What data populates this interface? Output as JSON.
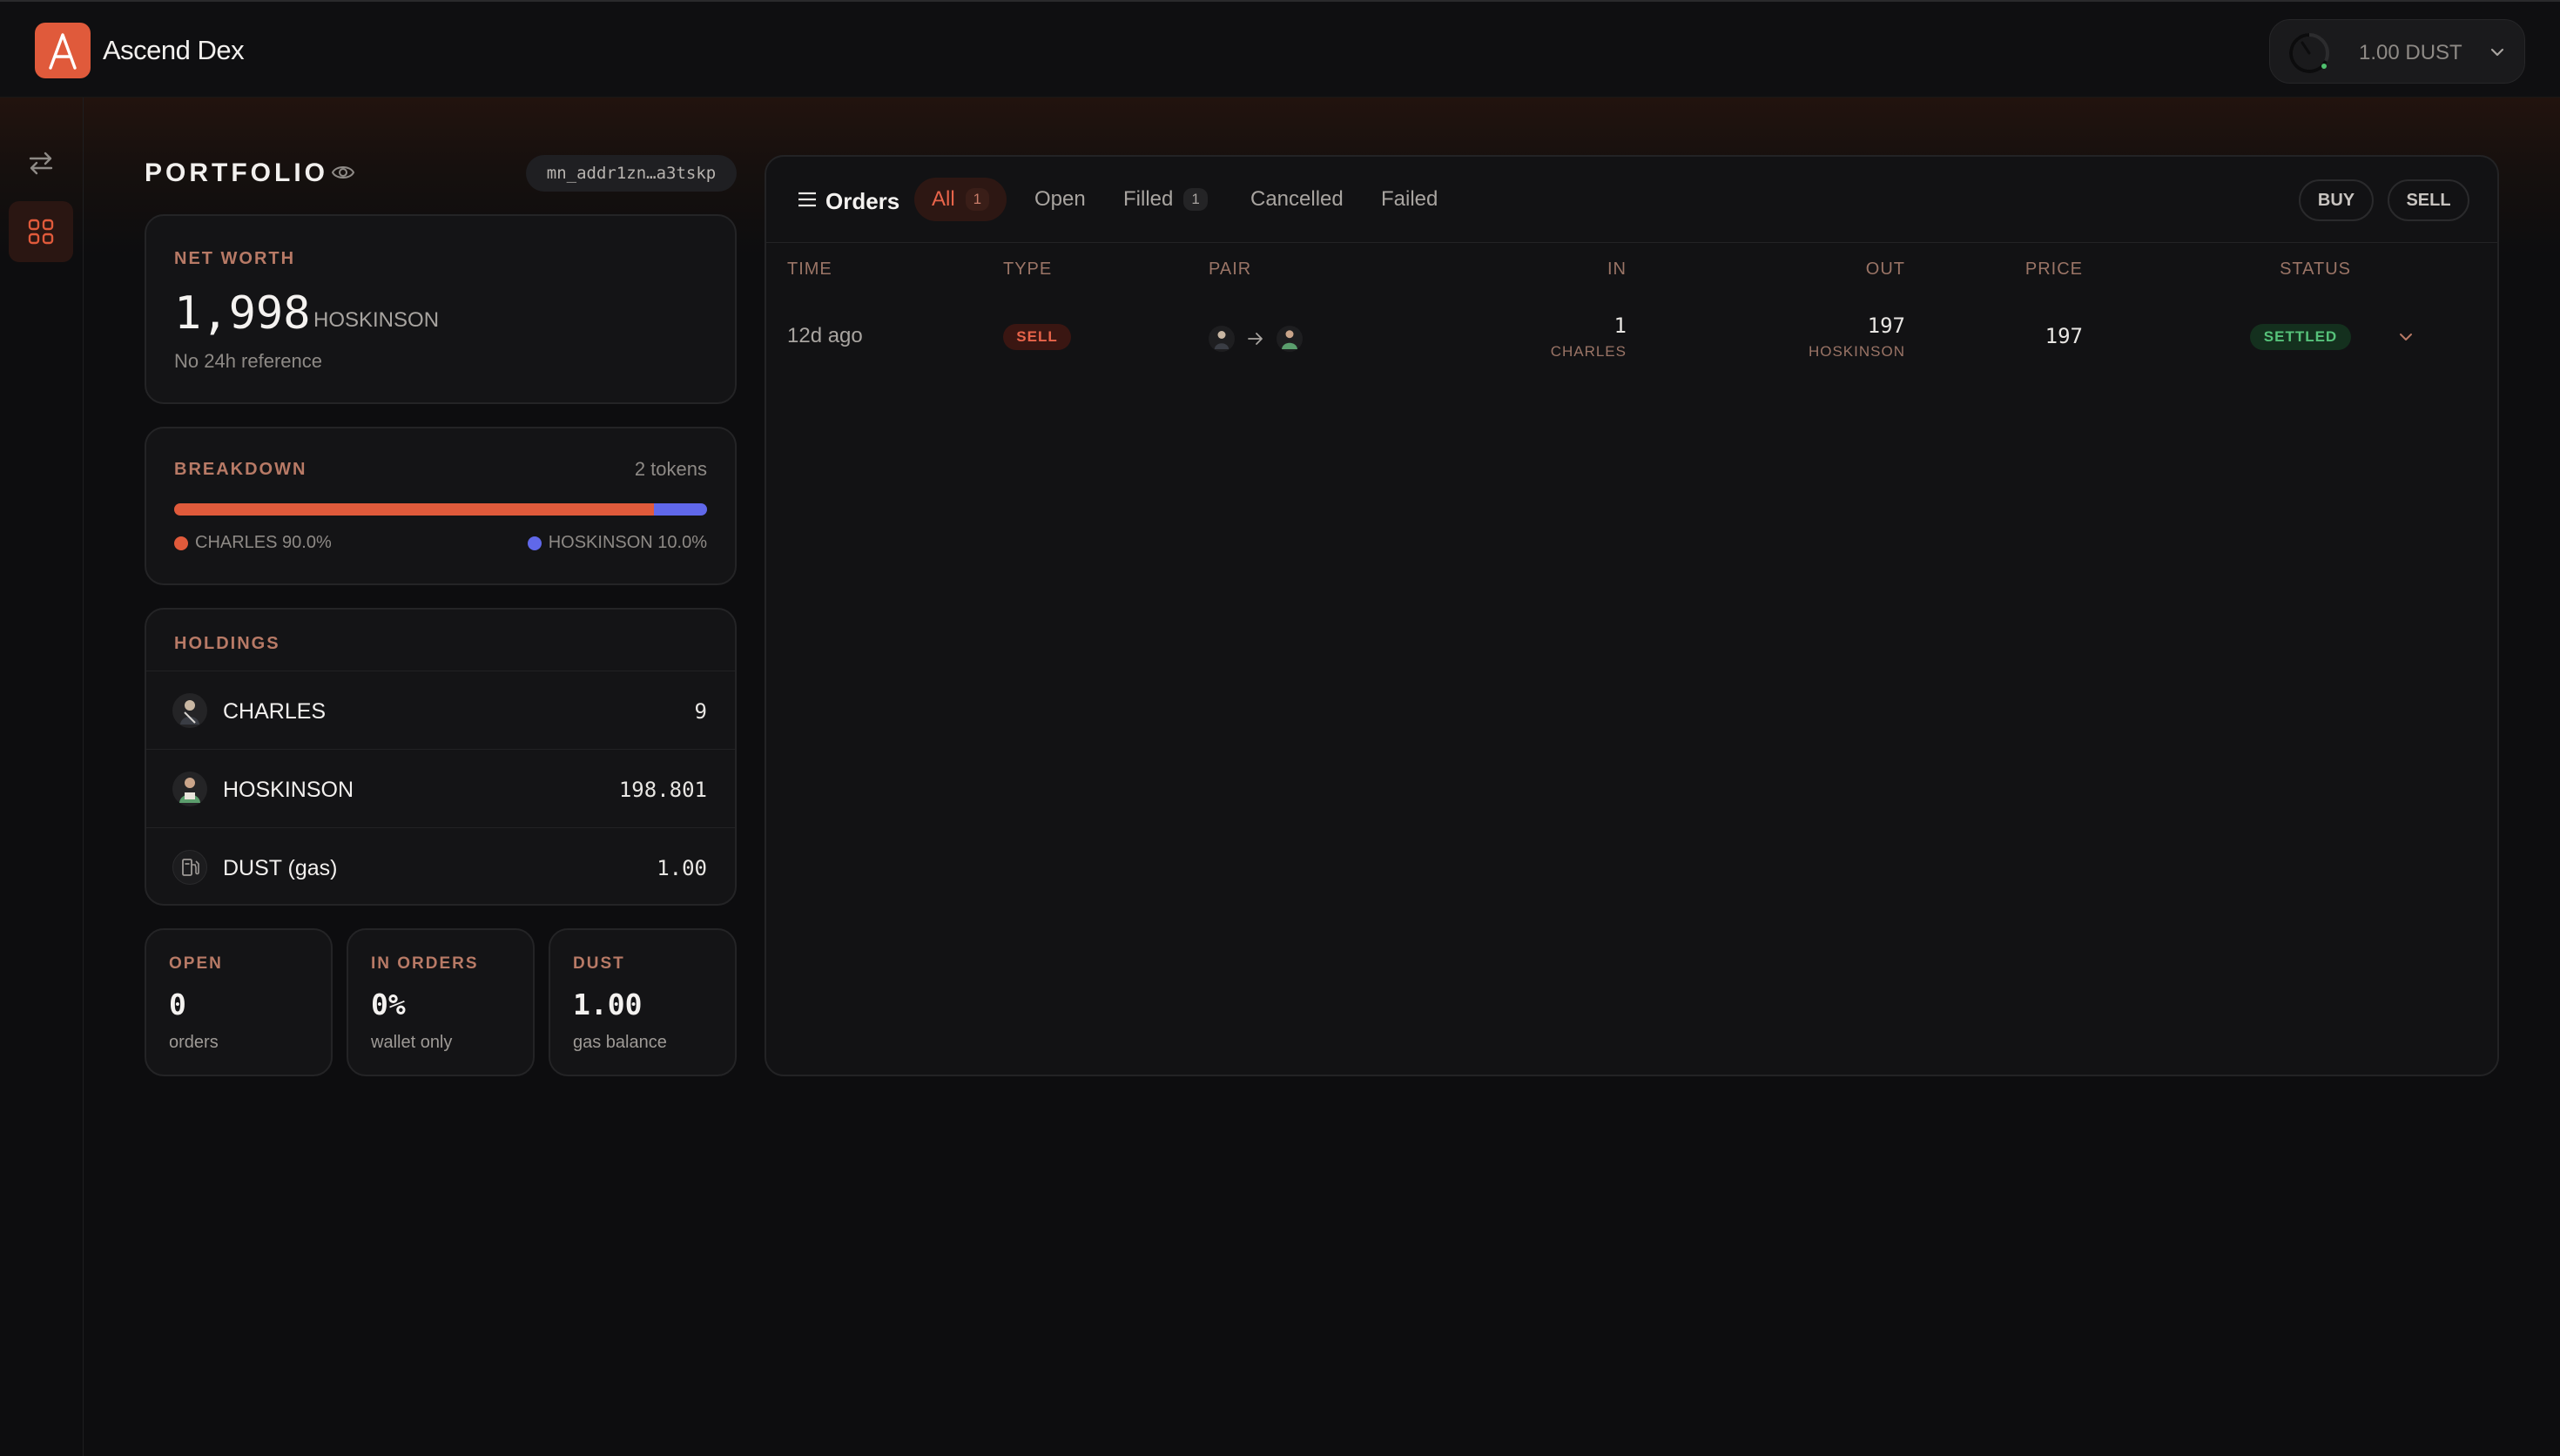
{
  "app": {
    "title": "Ascend Dex",
    "logo_letter": "A",
    "brand_color": "#e05a3b"
  },
  "wallet": {
    "balance_label": "1.00 DUST",
    "icon": "gauge-icon"
  },
  "sidebar": {
    "items": [
      {
        "name": "swap",
        "icon": "swap-arrows-icon",
        "active": false
      },
      {
        "name": "portfolio",
        "icon": "grid-icon",
        "active": true
      }
    ]
  },
  "portfolio": {
    "title": "PORTFOLIO",
    "address": "mn_addr1zn…a3tskp",
    "net_worth": {
      "label": "NET WORTH",
      "value": "1,998",
      "unit": "HOSKINSON",
      "sub": "No 24h reference"
    },
    "breakdown": {
      "label": "BREAKDOWN",
      "count": "2 tokens",
      "segments": [
        {
          "name": "CHARLES",
          "percent": 90.0,
          "legend": "CHARLES 90.0%",
          "color": "#e05a3b"
        },
        {
          "name": "HOSKINSON",
          "percent": 10.0,
          "legend": "HOSKINSON 10.0%",
          "color": "#6068ea"
        }
      ]
    },
    "holdings": {
      "label": "HOLDINGS",
      "rows": [
        {
          "name": "CHARLES",
          "value": "9",
          "icon": "charles-avatar-icon"
        },
        {
          "name": "HOSKINSON",
          "value": "198.801",
          "icon": "hoskinson-avatar-icon"
        },
        {
          "name": "DUST (gas)",
          "value": "1.00",
          "icon": "fuel-pump-icon"
        }
      ]
    },
    "stats": [
      {
        "label": "OPEN",
        "value": "0",
        "sub": "orders"
      },
      {
        "label": "IN ORDERS",
        "value": "0%",
        "sub": "wallet only"
      },
      {
        "label": "DUST",
        "value": "1.00",
        "sub": "gas balance"
      }
    ]
  },
  "orders": {
    "title": "Orders",
    "tabs": [
      {
        "label": "All",
        "count": "1",
        "active": true
      },
      {
        "label": "Open",
        "count": null,
        "active": false
      },
      {
        "label": "Filled",
        "count": "1",
        "active": false
      },
      {
        "label": "Cancelled",
        "count": null,
        "active": false
      },
      {
        "label": "Failed",
        "count": null,
        "active": false
      }
    ],
    "buy_label": "BUY",
    "sell_label": "SELL",
    "columns": [
      "TIME",
      "TYPE",
      "PAIR",
      "IN",
      "OUT",
      "PRICE",
      "STATUS"
    ],
    "rows": [
      {
        "time": "12d ago",
        "type": "SELL",
        "pair_from": "CHARLES",
        "pair_to": "HOSKINSON",
        "in_value": "1",
        "in_unit": "CHARLES",
        "out_value": "197",
        "out_unit": "HOSKINSON",
        "price": "197",
        "status": "SETTLED"
      }
    ]
  }
}
